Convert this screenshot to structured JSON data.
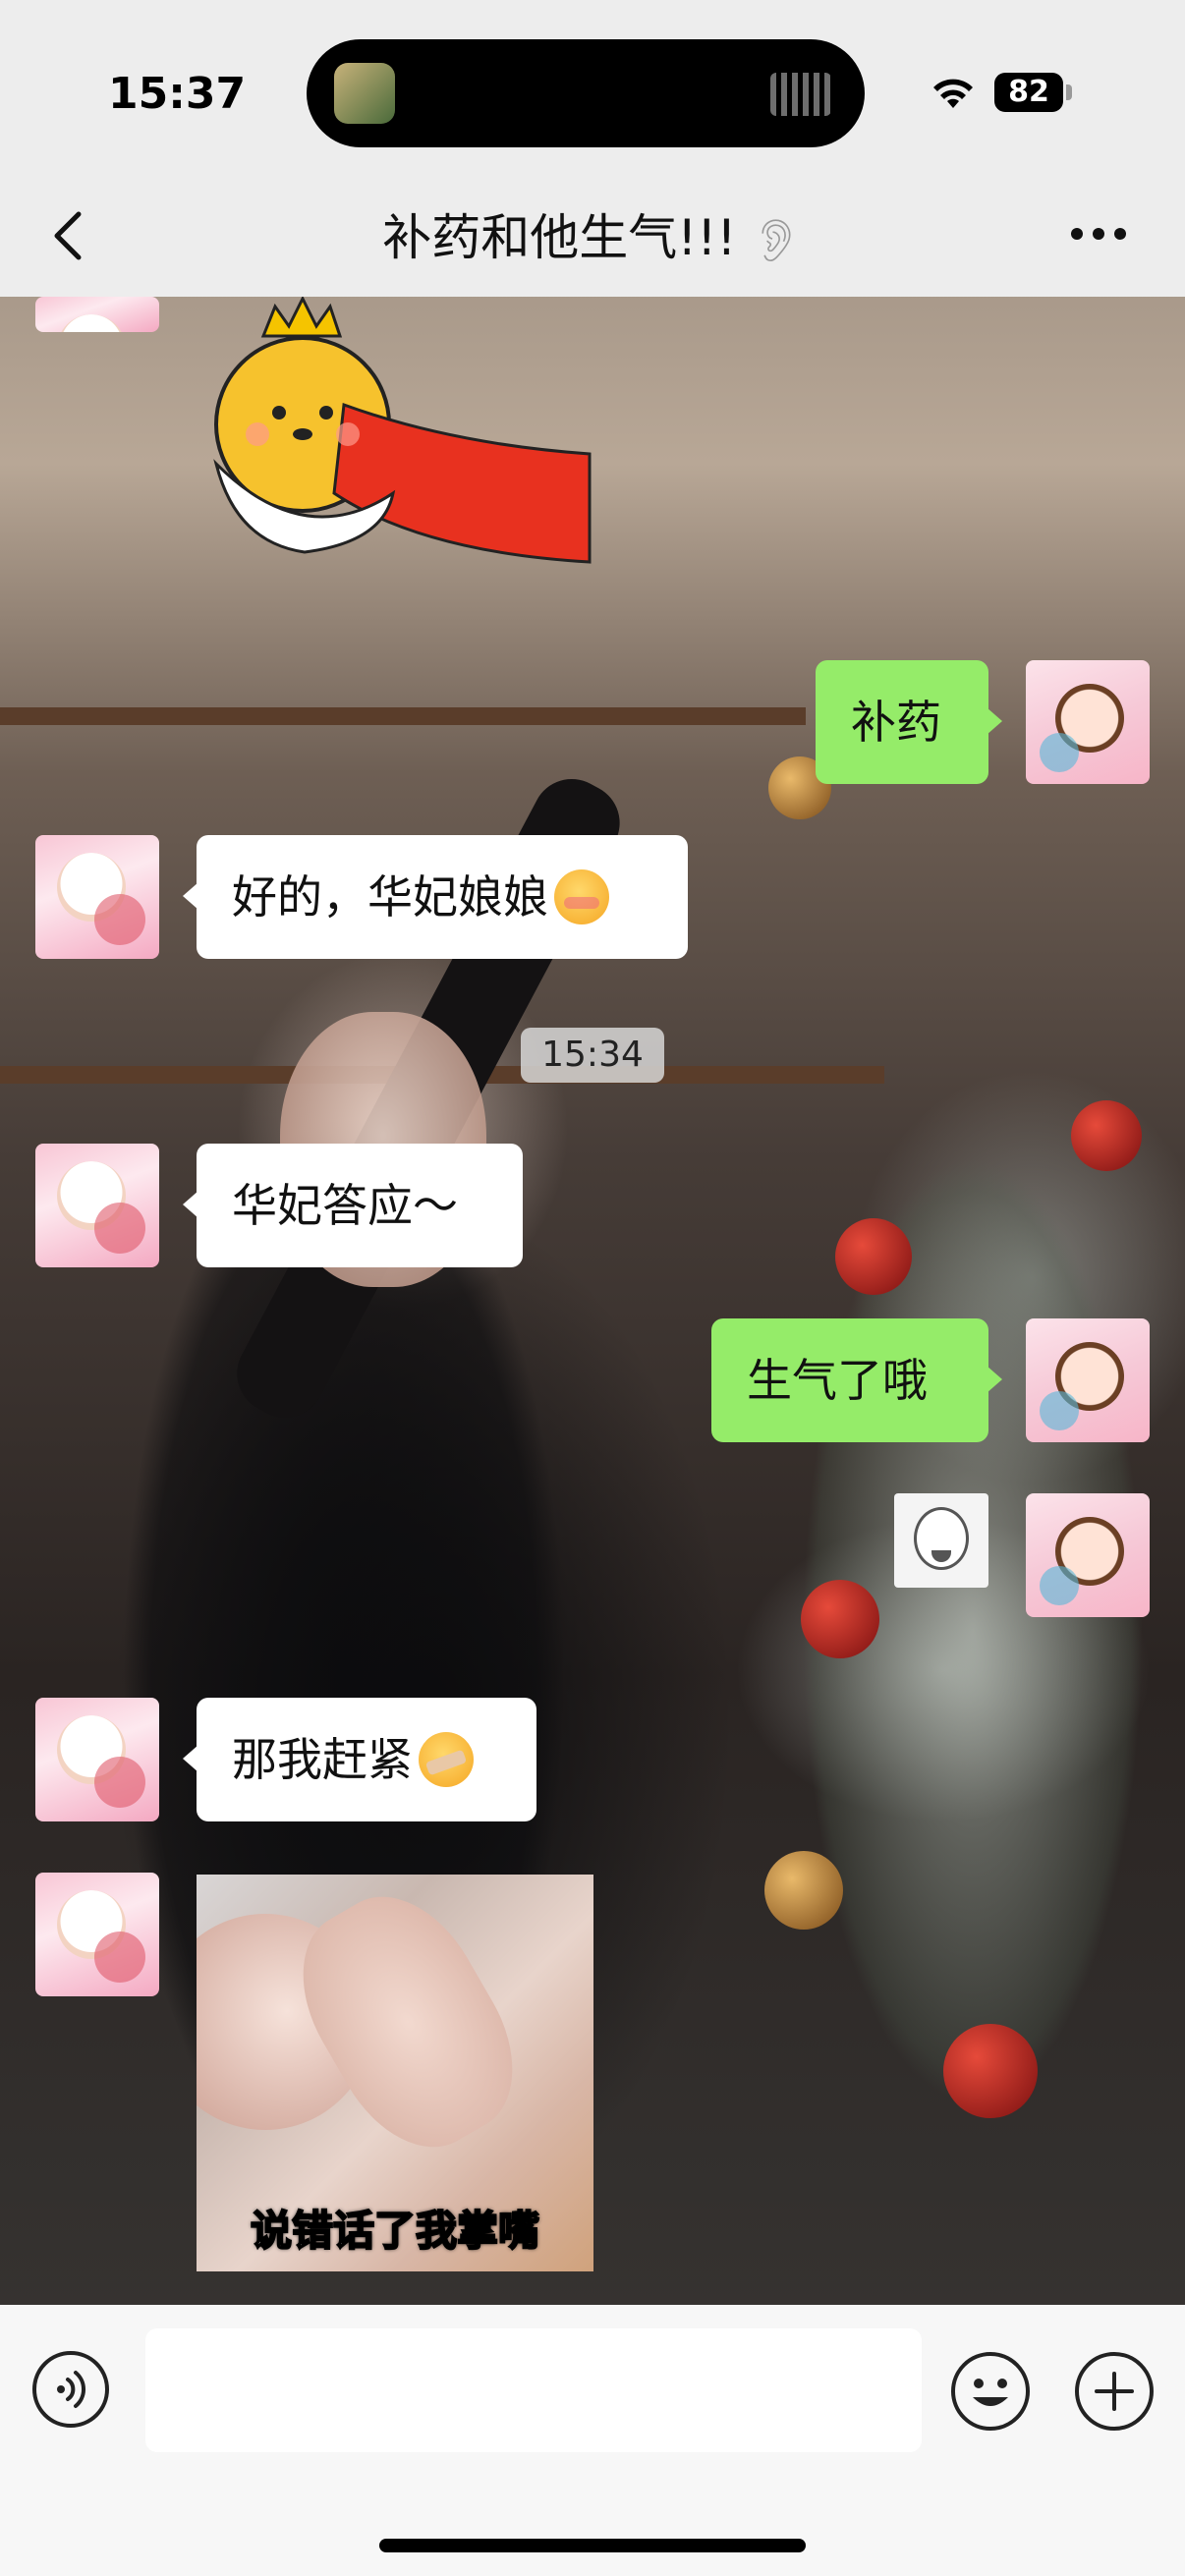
{
  "status_bar": {
    "time": "15:37",
    "battery": "82"
  },
  "nav": {
    "title": "补药和他生气!!!",
    "back_icon": "chevron-left-icon",
    "more_icon": "ellipsis-icon",
    "ear_icon": "ear-icon"
  },
  "messages": {
    "m1": {
      "text": "补药",
      "sender": "me"
    },
    "m2": {
      "text": "好的，华妃娘娘",
      "sender": "other",
      "emoji": "shy-smile-emoji"
    },
    "timestamp": "15:34",
    "m3": {
      "text": "华妃答应～",
      "sender": "other"
    },
    "m4": {
      "text": "生气了哦",
      "sender": "me"
    },
    "m5": {
      "text": "那我赶紧",
      "sender": "other",
      "emoji": "shushing-face-emoji"
    },
    "video_caption": "说错话了我掌嘴"
  },
  "input_bar": {
    "voice_icon": "voice-icon",
    "emoji_icon": "emoji-icon",
    "plus_icon": "plus-icon",
    "placeholder": ""
  },
  "colors": {
    "my_bubble": "#95ec69",
    "other_bubble": "#ffffff",
    "bar_bg": "#ededed"
  }
}
